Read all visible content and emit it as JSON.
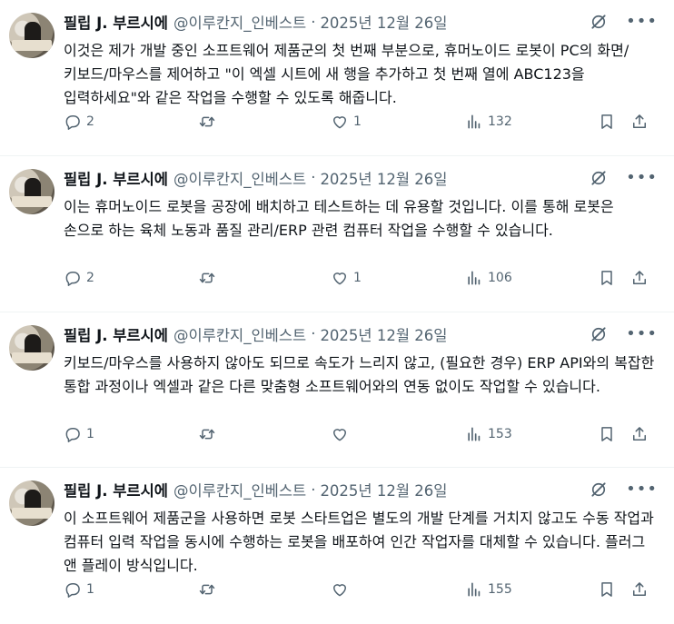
{
  "tweets": [
    {
      "author_name": "필립 J. 부르시에",
      "handle": "@이루칸지_인베스트",
      "separator": "·",
      "date": "2025년 12월 26일",
      "text": "이것은 제가 개발 중인 소프트웨어 제품군의 첫 번째 부분으로, 휴머노이드 로봇이 PC의 화면/키보드/마우스를 제어하고 \"이 엑셀 시트에 새 행을 추가하고 첫 번째 열에 ABC123을 입력하세요\"와 같은 작업을 수행할 수 있도록 해줍니다.",
      "replies": "2",
      "retweets": "",
      "likes": "1",
      "views": "132"
    },
    {
      "author_name": "필립 J. 부르시에",
      "handle": "@이루칸지_인베스트",
      "separator": "·",
      "date": "2025년 12월 26일",
      "text": "이는 휴머노이드 로봇을 공장에 배치하고 테스트하는 데 유용할 것입니다. 이를 통해 로봇은 손으로 하는 육체 노동과 품질 관리/ERP 관련 컴퓨터 작업을 수행할 수 있습니다.",
      "replies": "2",
      "retweets": "",
      "likes": "1",
      "views": "106"
    },
    {
      "author_name": "필립 J. 부르시에",
      "handle": "@이루칸지_인베스트",
      "separator": "·",
      "date": "2025년 12월 26일",
      "text": "키보드/마우스를 사용하지 않아도 되므로 속도가 느리지 않고, (필요한 경우) ERP API와의 복잡한 통합 과정이나 엑셀과 같은 다른 맞춤형 소프트웨어와의 연동 없이도 작업할 수 있습니다.",
      "replies": "1",
      "retweets": "",
      "likes": "",
      "views": "153"
    },
    {
      "author_name": "필립 J. 부르시에",
      "handle": "@이루칸지_인베스트",
      "separator": "·",
      "date": "2025년 12월 26일",
      "text": "이 소프트웨어 제품군을 사용하면 로봇 스타트업은 별도의 개발 단계를 거치지 않고도 수동 작업과 컴퓨터 입력 작업을 동시에 수행하는 로봇을 배포하여 인간 작업자를 대체할 수 있습니다. 플러그 앤 플레이 방식입니다.",
      "replies": "1",
      "retweets": "",
      "likes": "",
      "views": "155"
    }
  ],
  "icons": {
    "header": [
      "grok-icon",
      "more-icon"
    ],
    "actions": [
      "reply-icon",
      "retweet-icon",
      "like-icon",
      "views-icon",
      "bookmark-icon",
      "share-icon"
    ]
  },
  "colors": {
    "text": "#0f1419",
    "secondary": "#536471",
    "divider": "#eff3f4"
  }
}
